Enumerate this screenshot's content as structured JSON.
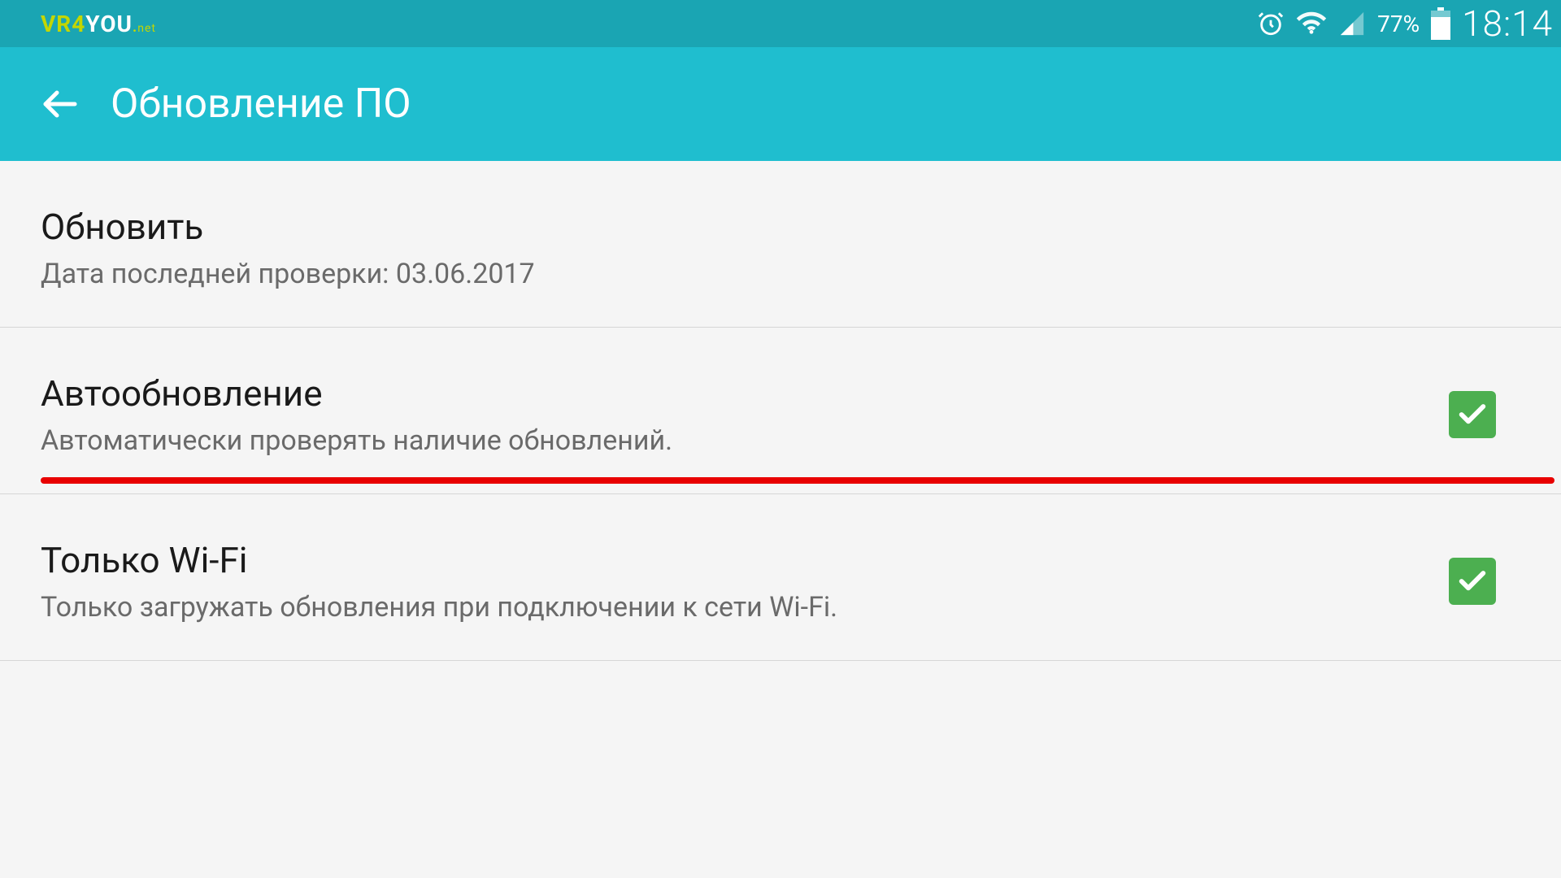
{
  "status_bar": {
    "watermark": {
      "part1": "VR4",
      "part2": "YOU",
      "dot": ".",
      "ext": "net"
    },
    "battery_text": "77%",
    "time": "18:14"
  },
  "app_bar": {
    "title": "Обновление ПО"
  },
  "items": [
    {
      "title": "Обновить",
      "subtitle": "Дата последней проверки: 03.06.2017",
      "has_checkbox": false,
      "highlight": false
    },
    {
      "title": "Автообновление",
      "subtitle": "Автоматически проверять наличие обновлений.",
      "has_checkbox": true,
      "highlight": true
    },
    {
      "title": "Только Wi-Fi",
      "subtitle": "Только загружать обновления при подключении к сети Wi-Fi.",
      "has_checkbox": true,
      "highlight": false
    }
  ]
}
